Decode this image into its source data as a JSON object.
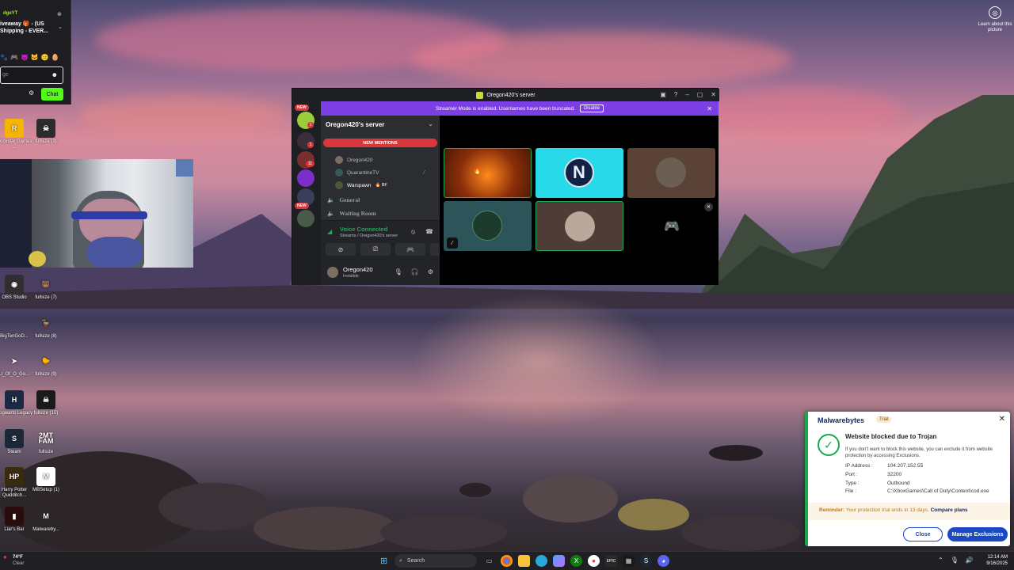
{
  "chat_widget": {
    "username": "dgeYT",
    "promo_text": "iveaway 🎁 - (US Shipping - EVER...",
    "input_placeholder": "ge",
    "chat_button": "Chat"
  },
  "desktop_icons": [
    {
      "label": "Rockstar Games ...",
      "glyph": "R",
      "color": "#f4b400"
    },
    {
      "label": "fullsize (3)",
      "glyph": "☠",
      "color": "#2c2c2c"
    },
    {
      "label": "OBS Studio",
      "glyph": "◉",
      "color": "#302e31"
    },
    {
      "label": "fullsize (7)",
      "glyph": "🐻",
      "color": "#00000000"
    },
    {
      "label": "BigTenGoD...",
      "glyph": "",
      "color": "#00000000"
    },
    {
      "label": "fullsize (8)",
      "glyph": "🦆",
      "color": "#00000000"
    },
    {
      "label": "U_Of_O_Go...",
      "glyph": "➤",
      "color": "#00000000"
    },
    {
      "label": "fullsize (9)",
      "glyph": "🐤",
      "color": "#00000000"
    },
    {
      "label": "Hogwarts Legacy",
      "glyph": "H",
      "color": "#1b2a44"
    },
    {
      "label": "fullsize (10)",
      "glyph": "☠",
      "color": "#1a1a1a"
    },
    {
      "label": "Steam",
      "glyph": "S",
      "color": "#1b2838"
    },
    {
      "label": "fullsize",
      "glyph": "2MT FAM",
      "color": "#00000000"
    },
    {
      "label": "Harry Potter Quidditch...",
      "glyph": "HP",
      "color": "#3a2a10"
    },
    {
      "label": "MBSetup (1)",
      "glyph": "M",
      "color": "#ffffff"
    },
    {
      "label": "Liar's Bar",
      "glyph": "▮",
      "color": "#2b0c0c"
    },
    {
      "label": "Malwareby...",
      "glyph": "M",
      "color": "#00000000"
    }
  ],
  "top_right": {
    "learn_label": "Learn about this picture"
  },
  "discord": {
    "window_title": "Oregon420's server",
    "banner_text": "Streamer Mode is enabled. Usernames have been truncated.",
    "banner_button": "Disable",
    "badge_new": "NEW",
    "server_name": "Oregon420's server",
    "mentions_pill": "NEW MENTIONS",
    "voice_users": [
      {
        "name": "Oregon420",
        "color": "#7b6f62"
      },
      {
        "name": "QuarantineTV",
        "color": "#355a5a"
      },
      {
        "name": "Warspawn",
        "color": "#4a5a3a",
        "tag": "🔥 BF"
      }
    ],
    "channels": [
      "General",
      "Waiting Room"
    ],
    "voice_status": "Voice Connected",
    "voice_sub": "Streams / Oregon420's server",
    "user_name": "Oregon420",
    "user_status": "Invisible",
    "guild_badges": [
      "1",
      "1",
      "11"
    ]
  },
  "malwarebytes": {
    "brand": "Malwarebytes",
    "trial": "Trial",
    "headline": "Website blocked due to Trojan",
    "description": "If you don't want to block this website, you can exclude it from website protection by accessing Exclusions.",
    "details": [
      {
        "k": "IP Address :",
        "v": "104.207.152.55"
      },
      {
        "k": "Port :",
        "v": "32200"
      },
      {
        "k": "Type :",
        "v": "Outbound"
      },
      {
        "k": "File :",
        "v": "C:\\XboxGames\\Call of Duty\\Content\\cod.exe"
      }
    ],
    "reminder_label": "Reminder:",
    "reminder_text": "Your protection trial ends in 13 days.",
    "reminder_link": "Compare plans",
    "close_button": "Close",
    "manage_button": "Manage Exclusions"
  },
  "taskbar": {
    "temperature": "74°F",
    "condition": "Clear",
    "search_placeholder": "Search",
    "time": "12:14 AM",
    "date": "9/16/2025"
  }
}
